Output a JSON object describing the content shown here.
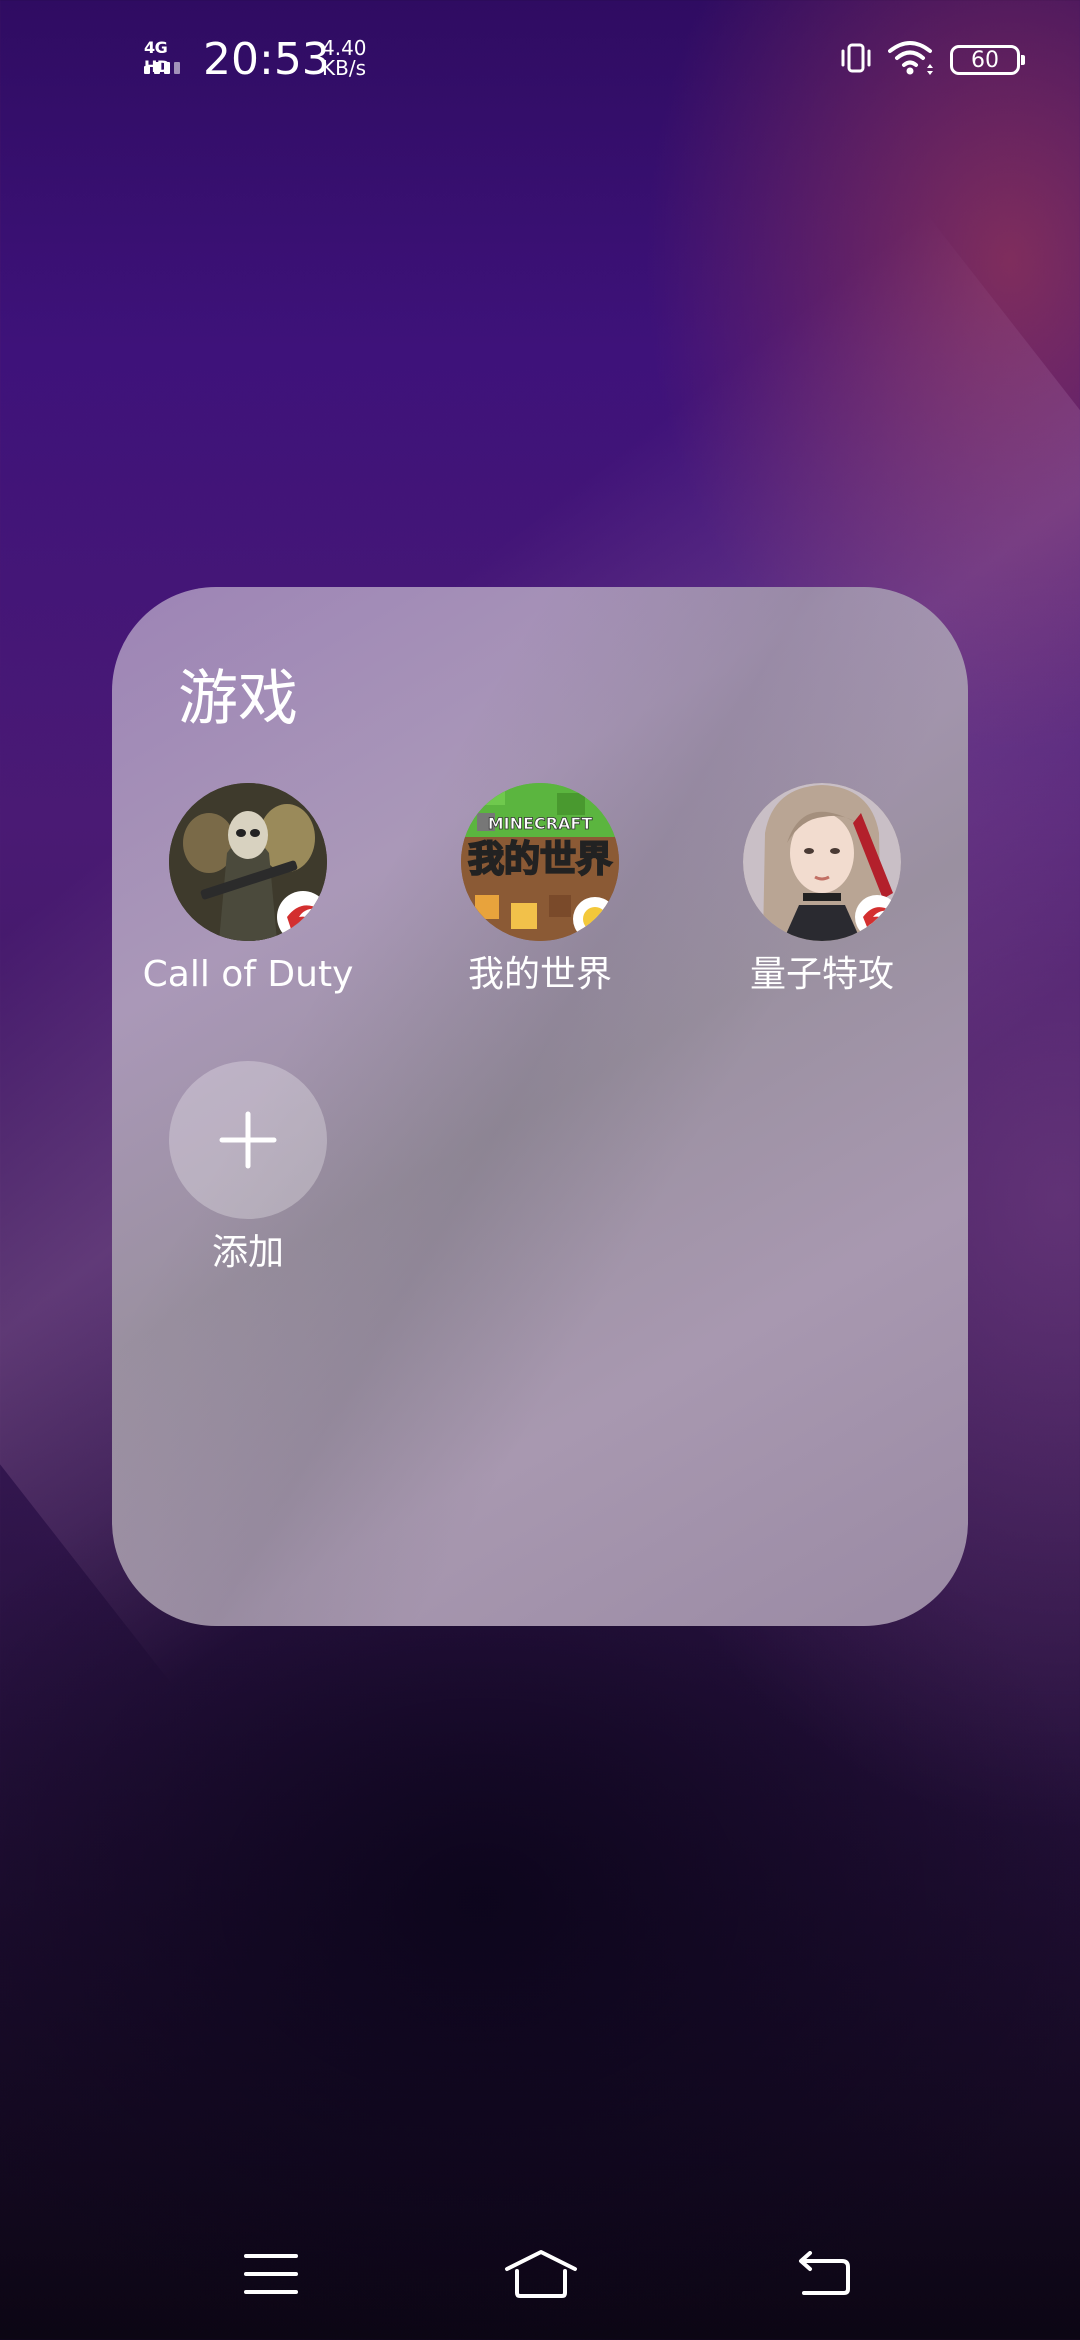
{
  "status_bar": {
    "network_type": "4G HD",
    "time": "20:53",
    "net_speed_value": "4.40",
    "net_speed_unit": "KB/s",
    "battery_level": "60",
    "icons": [
      "signal-icon",
      "vibrate-icon",
      "wifi-icon",
      "battery-icon"
    ]
  },
  "folder": {
    "title": "游戏",
    "apps": [
      {
        "label": "Call of Duty",
        "icon": "call-of-duty-app-icon"
      },
      {
        "label": "我的世界",
        "icon": "minecraft-app-icon",
        "icon_text_top": "MINECRAFT",
        "icon_text_main": "我的世界"
      },
      {
        "label": "量子特攻",
        "icon": "quantum-strike-app-icon"
      }
    ],
    "add_button": {
      "label": "添加",
      "icon": "plus-icon"
    }
  },
  "nav_bar": {
    "buttons": [
      "menu-icon",
      "home-icon",
      "back-icon"
    ]
  },
  "colors": {
    "background_top": "#2f0c62",
    "background_bottom": "#0c0614",
    "folder_panel": "#a898b0",
    "text": "#ffffff"
  }
}
